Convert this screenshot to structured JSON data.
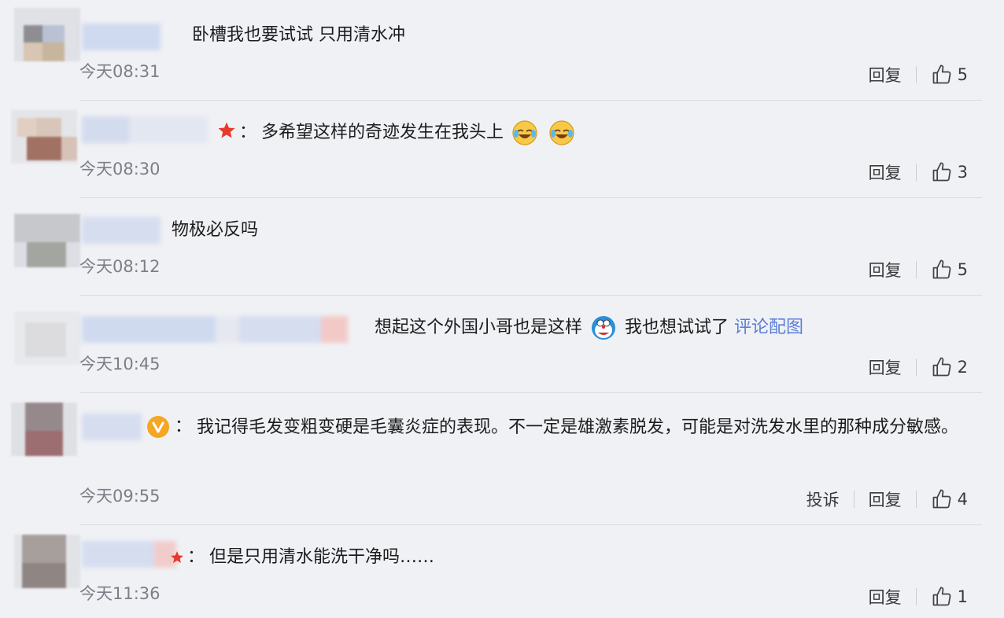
{
  "comments": [
    {
      "text": "卧槽我也要试试 只用清水冲",
      "time": "今天08:31",
      "reply_label": "回复",
      "likes": "5"
    },
    {
      "text": "多希望这样的奇迹发生在我头上",
      "time": "今天08:30",
      "reply_label": "回复",
      "likes": "3",
      "emojis": [
        "laugh-cry-emoji",
        "laugh-cry-emoji"
      ]
    },
    {
      "text": "物极必反吗",
      "time": "今天08:12",
      "reply_label": "回复",
      "likes": "5"
    },
    {
      "text": "想起这个外国小哥也是这样",
      "text2": "我也想试试了",
      "link": "评论配图",
      "time": "今天10:45",
      "reply_label": "回复",
      "likes": "2",
      "emojis": [
        "doraemon-emoji"
      ]
    },
    {
      "text": "我记得毛发变粗变硬是毛囊炎症的表现。不一定是雄激素脱发，可能是对洗发水里的那种成分敏感。",
      "time": "今天09:55",
      "report_label": "投诉",
      "reply_label": "回复",
      "likes": "4"
    },
    {
      "text": "但是只用清水能洗干净吗……",
      "time": "今天11:36",
      "reply_label": "回复",
      "likes": "1"
    }
  ],
  "colors": {
    "background": "#f0f1f5",
    "link": "#5b7fd6",
    "star_badge": "#e8392b",
    "verified_badge": "#f5a623"
  },
  "icons": {
    "like": "thumbs-up-icon",
    "star": "star-badge-icon",
    "verified": "verified-v-icon"
  }
}
